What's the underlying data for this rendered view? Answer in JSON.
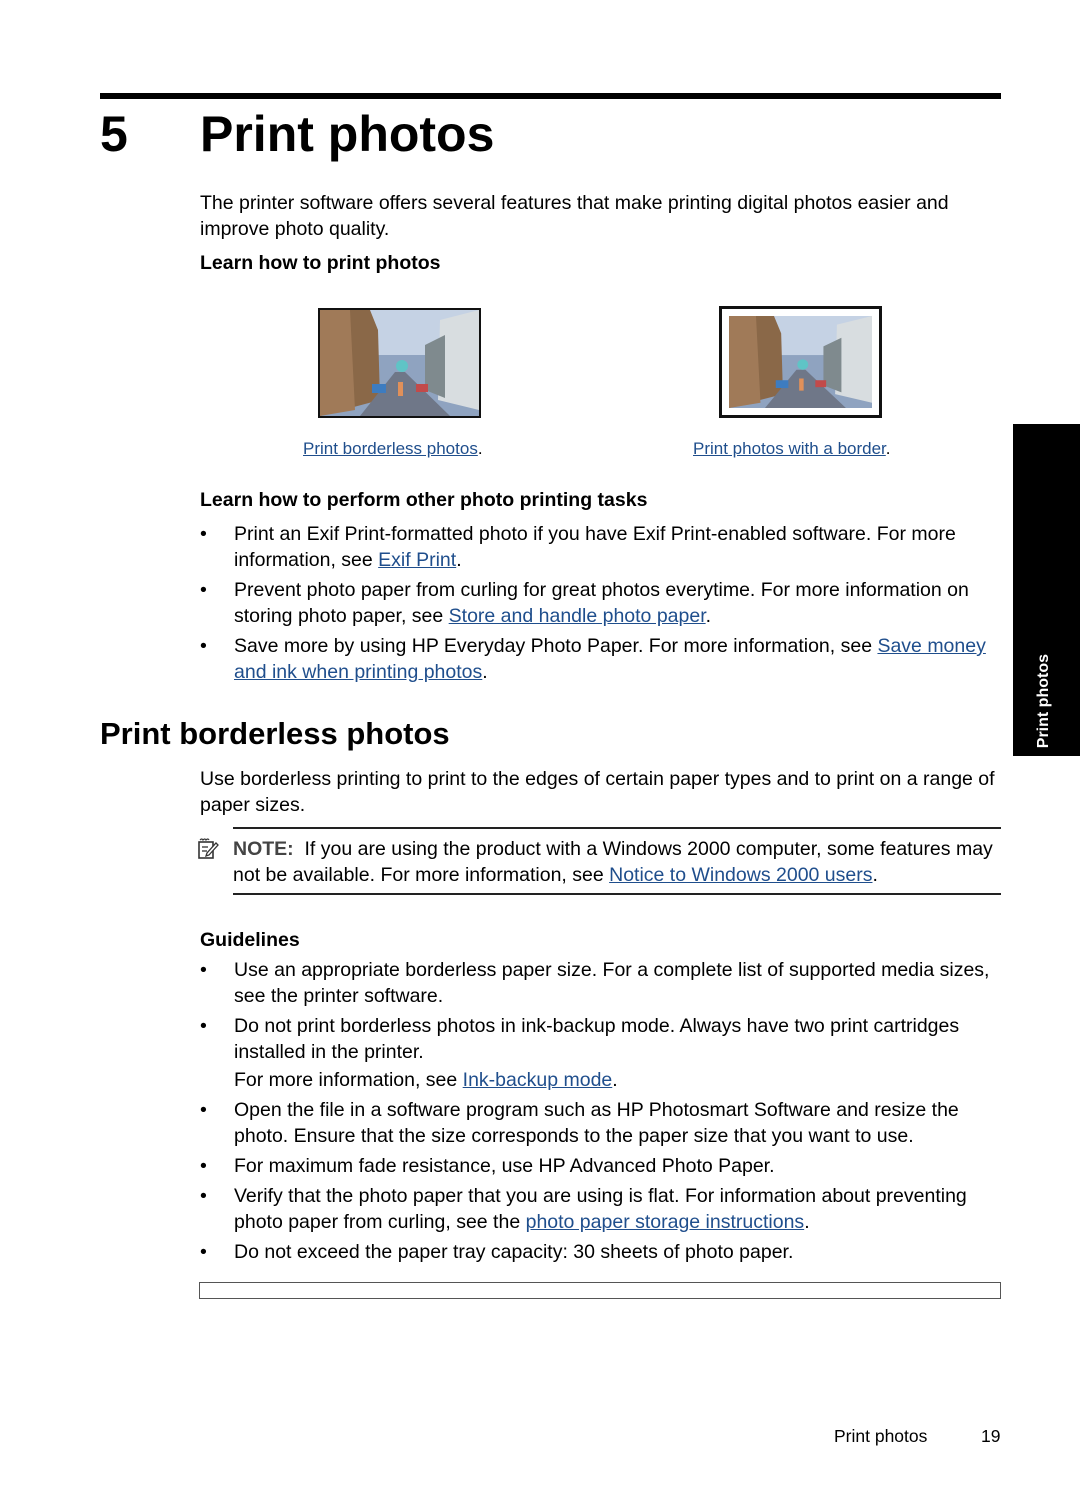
{
  "chapter": {
    "number": "5",
    "title": "Print photos"
  },
  "intro": {
    "text": "The printer software offers several features that make printing digital photos easier and improve photo quality."
  },
  "learn_print": {
    "heading": "Learn how to print photos",
    "items": [
      {
        "caption_link": "Print borderless photos",
        "caption_suffix": ".",
        "image": "borderless-street-photo"
      },
      {
        "caption_link": "Print photos with a border",
        "caption_suffix": ".",
        "image": "bordered-street-photo"
      }
    ]
  },
  "other_tasks": {
    "heading": "Learn how to perform other photo printing tasks",
    "items": [
      {
        "text": "Print an Exif Print-formatted photo if you have Exif Print-enabled software. For more information, see ",
        "link": "Exif Print",
        "suffix": "."
      },
      {
        "text": "Prevent photo paper from curling for great photos everytime. For more information on storing photo paper, see ",
        "link": "Store and handle photo paper",
        "suffix": "."
      },
      {
        "text": "Save more by using HP Everyday Photo Paper. For more information, see ",
        "link": "Save money and ink when printing photos",
        "suffix": "."
      }
    ]
  },
  "side_tab": {
    "label": "Print photos"
  },
  "borderless": {
    "heading": "Print borderless photos",
    "text": "Use borderless printing to print to the edges of certain paper types and to print on a range of paper sizes.",
    "note": {
      "icon": "note-pencil-icon",
      "label": "NOTE:",
      "text": "If you are using the product with a Windows 2000 computer, some features may not be available. For more information, see ",
      "link": "Notice to Windows 2000 users",
      "suffix": "."
    }
  },
  "guidelines": {
    "heading": "Guidelines",
    "items": [
      {
        "text": "Use an appropriate borderless paper size. For a complete list of supported media sizes, see the printer software.",
        "link": "",
        "suffix": ""
      },
      {
        "text": "Do not print borderless photos in ink-backup mode. Always have two print cartridges installed in the printer.",
        "extra_text": "For more information, see ",
        "link": "Ink-backup mode",
        "suffix": "."
      },
      {
        "text": "Open the file in a software program such as HP Photosmart Software and resize the photo. Ensure that the size corresponds to the paper size that you want to use.",
        "link": "",
        "suffix": ""
      },
      {
        "text": "For maximum fade resistance, use HP Advanced Photo Paper.",
        "link": "",
        "suffix": ""
      },
      {
        "text": "Verify that the photo paper that you are using is flat. For information about preventing photo paper from curling, see the ",
        "link": "photo paper storage instructions",
        "suffix": "."
      },
      {
        "text": "Do not exceed the paper tray capacity: 30 sheets of photo paper.",
        "link": "",
        "suffix": ""
      }
    ]
  },
  "footer": {
    "section": "Print photos",
    "page_number": "19"
  },
  "colors": {
    "link": "#1f4e8c",
    "text": "#000000",
    "side_tab": "#000000"
  }
}
